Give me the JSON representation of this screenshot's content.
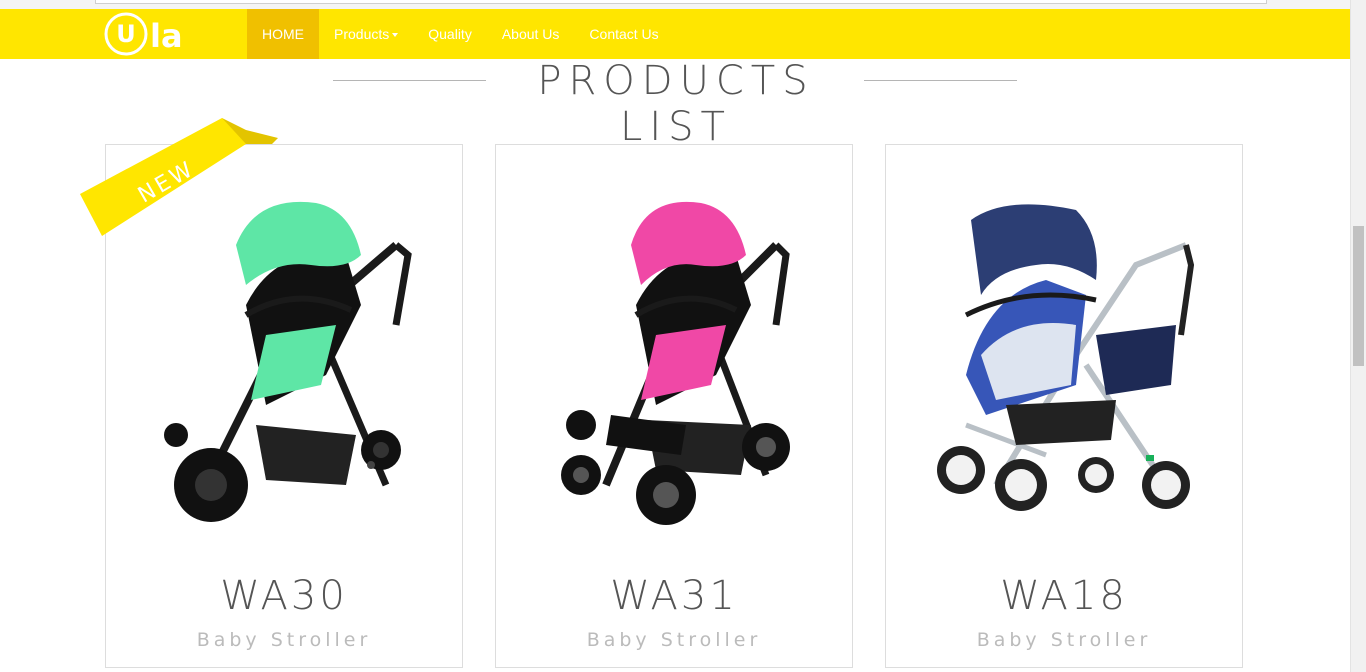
{
  "brand": {
    "logo_text": "la",
    "logo_mark": "U"
  },
  "nav": {
    "items": [
      {
        "label": "HOME",
        "active": true
      },
      {
        "label": "Products",
        "dropdown": true
      },
      {
        "label": "Quality"
      },
      {
        "label": "About Us"
      },
      {
        "label": "Contact Us"
      }
    ]
  },
  "section": {
    "title": "PRODUCTS LIST"
  },
  "badge": {
    "label": "NEW"
  },
  "products": [
    {
      "model": "WA30",
      "subtitle": "Baby Stroller",
      "accent": "#5ee6a6"
    },
    {
      "model": "WA31",
      "subtitle": "Baby Stroller",
      "accent": "#f048a6"
    },
    {
      "model": "WA18",
      "subtitle": "Baby Stroller",
      "accent": "#2c3e74"
    }
  ],
  "colors": {
    "navbar": "#ffe600",
    "nav_active": "#f0c000",
    "ribbon": "#ffe600"
  }
}
